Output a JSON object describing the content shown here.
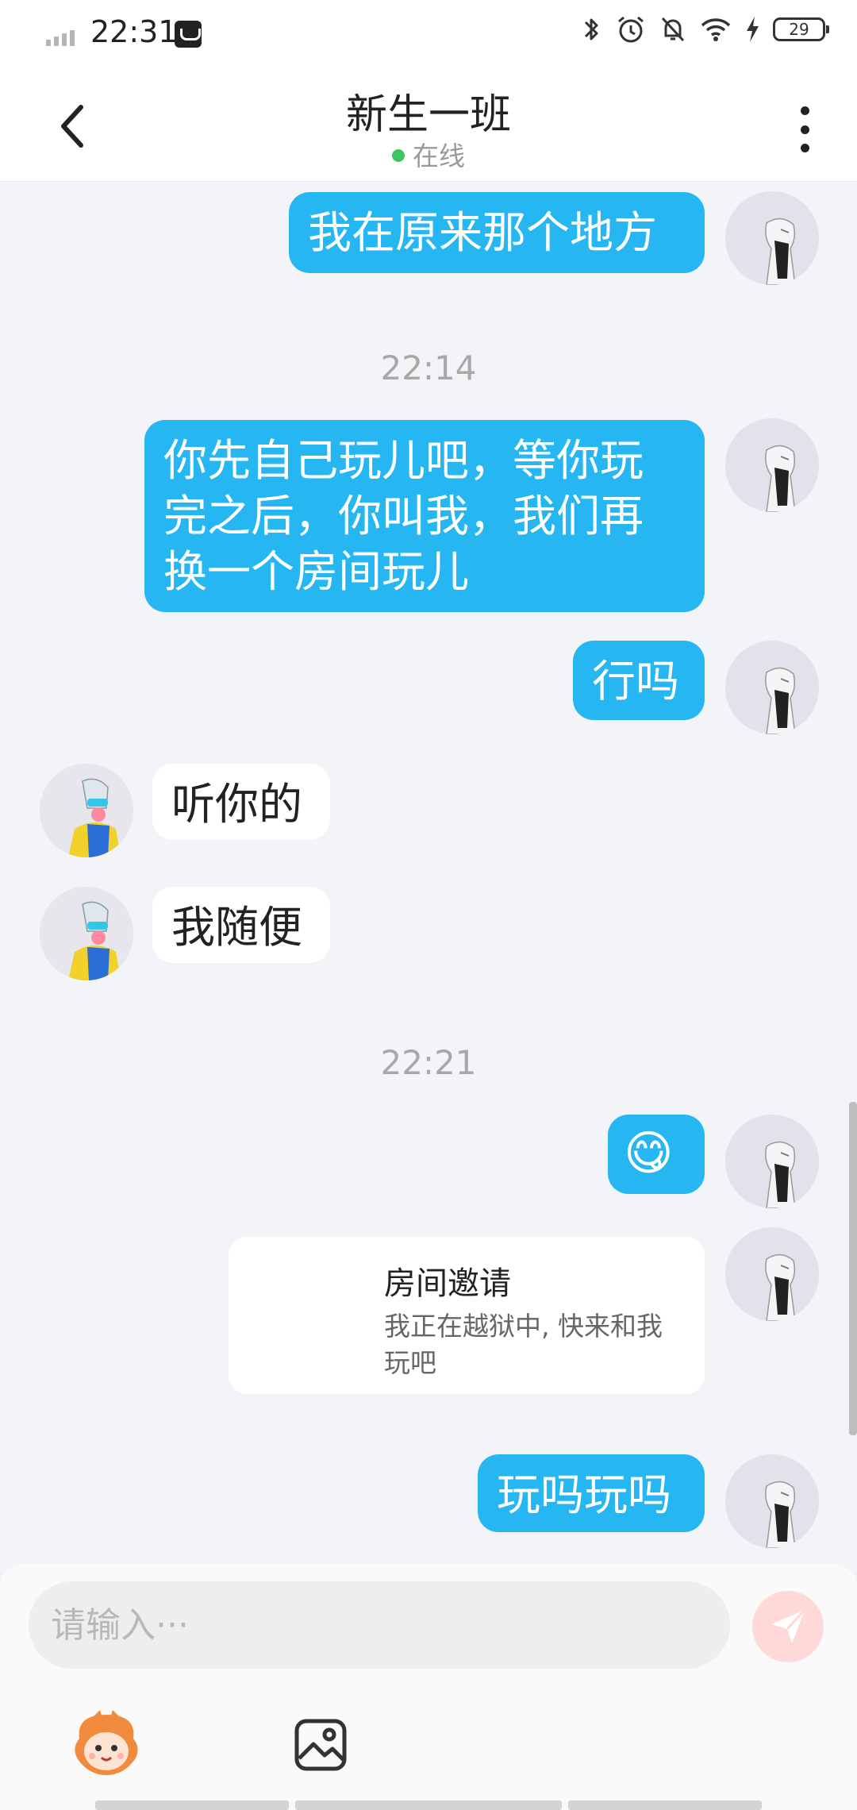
{
  "status_bar": {
    "time": "22:31",
    "battery": "29"
  },
  "header": {
    "title": "新生一班",
    "presence": "在线"
  },
  "colors": {
    "outgoing_bubble": "#26b6f2",
    "incoming_bubble": "#ffffff",
    "online_dot": "#3ec760",
    "background": "#f2f4f7"
  },
  "messages": [
    {
      "dir": "out",
      "text": "我在原来那个地方"
    },
    {
      "timestamp": "22:14"
    },
    {
      "dir": "out",
      "text": "你先自己玩儿吧，等你玩完之后，你叫我，我们再换一个房间玩儿"
    },
    {
      "dir": "out",
      "text": "行吗"
    },
    {
      "dir": "in",
      "text": "听你的"
    },
    {
      "dir": "in",
      "text": "我随便"
    },
    {
      "timestamp": "22:21"
    },
    {
      "dir": "out",
      "text": "😋"
    },
    {
      "dir": "out",
      "type": "invite",
      "title": "房间邀请",
      "desc": "我正在越狱中, 快来和我玩吧"
    },
    {
      "dir": "out",
      "text": "玩吗玩吗"
    }
  ],
  "composer": {
    "placeholder": "请输入···"
  },
  "icons": [
    "back-icon",
    "more-icon",
    "send-icon",
    "sticker-icon",
    "image-icon"
  ]
}
